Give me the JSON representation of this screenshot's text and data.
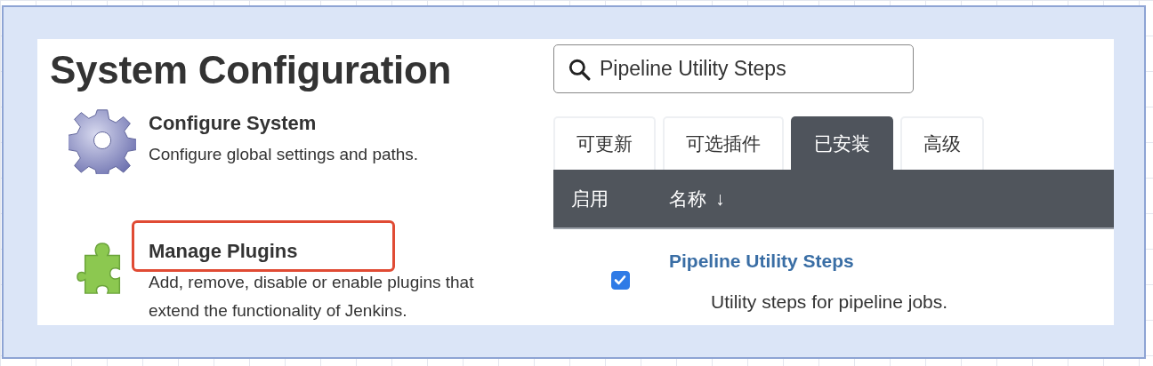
{
  "config": {
    "title": "System Configuration",
    "items": [
      {
        "kind": "gear",
        "title": "Configure System",
        "description_lines": [
          "Configure global settings and paths."
        ],
        "highlighted": false
      },
      {
        "kind": "puzzle",
        "title": "Manage Plugins",
        "description_lines": [
          "Add, remove, disable or enable plugins that",
          "extend the functionality of Jenkins."
        ],
        "highlighted": true
      }
    ]
  },
  "plugins": {
    "search": {
      "value": "Pipeline Utility Steps"
    },
    "tabs": [
      {
        "label": "可更新",
        "selected": false
      },
      {
        "label": "可选插件",
        "selected": false
      },
      {
        "label": "已安装",
        "selected": true
      },
      {
        "label": "高级",
        "selected": false
      }
    ],
    "table": {
      "columns": [
        {
          "label": "启用"
        },
        {
          "label": "名称",
          "sort_arrow": "↓"
        }
      ],
      "rows": [
        {
          "enabled": true,
          "name": "Pipeline Utility Steps",
          "description": "Utility steps for pipeline jobs."
        }
      ]
    }
  }
}
